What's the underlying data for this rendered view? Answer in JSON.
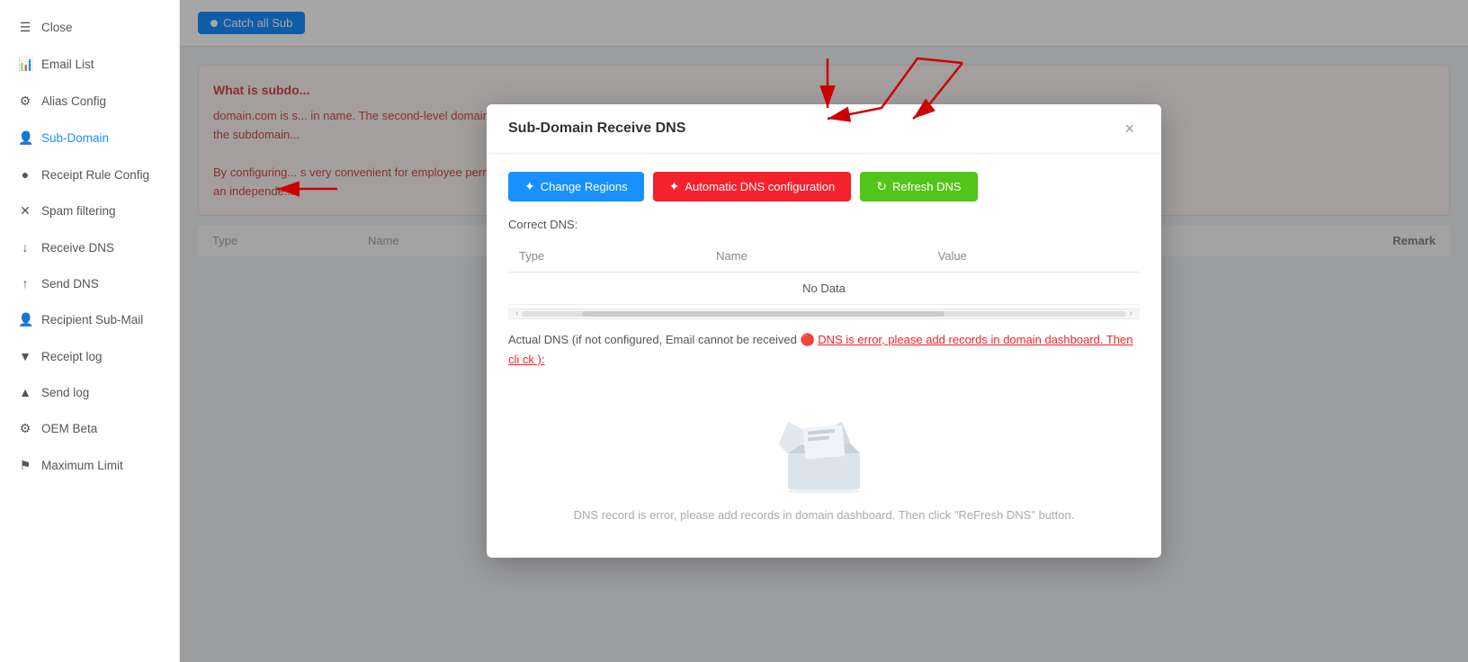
{
  "sidebar": {
    "items": [
      {
        "id": "close",
        "label": "Close",
        "icon": "☰",
        "active": false
      },
      {
        "id": "email-list",
        "label": "Email List",
        "icon": "📊",
        "active": false
      },
      {
        "id": "alias-config",
        "label": "Alias Config",
        "icon": "⚙",
        "active": false
      },
      {
        "id": "sub-domain",
        "label": "Sub-Domain",
        "icon": "👤",
        "active": true
      },
      {
        "id": "receipt-rule-config",
        "label": "Receipt Rule Config",
        "icon": "●",
        "active": false
      },
      {
        "id": "spam-filtering",
        "label": "Spam filtering",
        "icon": "✕",
        "active": false
      },
      {
        "id": "receive-dns",
        "label": "Receive DNS",
        "icon": "↓",
        "active": false
      },
      {
        "id": "send-dns",
        "label": "Send DNS",
        "icon": "↑",
        "active": false
      },
      {
        "id": "recipient-sub-mail",
        "label": "Recipient Sub-Mail",
        "icon": "👤",
        "active": false
      },
      {
        "id": "receipt-log",
        "label": "Receipt log",
        "icon": "▼",
        "active": false
      },
      {
        "id": "send-log",
        "label": "Send log",
        "icon": "▲",
        "active": false
      },
      {
        "id": "oem-beta",
        "label": "OEM Beta",
        "icon": "⚙",
        "active": false
      },
      {
        "id": "maximum-limit",
        "label": "Maximum Limit",
        "icon": "⚑",
        "active": false
      }
    ]
  },
  "topbar": {
    "catch_all_tab": "Catch all Sub"
  },
  "background_content": {
    "what_is_subdomain_title": "What is subdo...",
    "description1": "domain.com is s... in name. The second-level domain name and third-level domain name here a",
    "description2": "the subdomain...",
    "description3": "By configuring... s very convenient for employee permission management. Each employee use",
    "description4": "an independe...",
    "table_headers": [
      "Type",
      "Name",
      "Value"
    ],
    "remark_label": "Remark"
  },
  "modal": {
    "title": "Sub-Domain Receive DNS",
    "close_button": "×",
    "buttons": {
      "change_regions": "Change Regions",
      "auto_dns": "Automatic DNS configuration",
      "refresh_dns": "Refresh DNS"
    },
    "correct_dns_label": "Correct DNS:",
    "table": {
      "headers": [
        "Type",
        "Name",
        "Value"
      ],
      "no_data": "No Data"
    },
    "actual_dns_label": "Actual DNS (if not configured, Email cannot be received",
    "error_text": "DNS is error, please add records in domain dashboard. Then cli ck ):",
    "empty_state_text": "DNS record is error, please add records in domain dashboard. Then click \"ReFresh DNS\" button."
  }
}
